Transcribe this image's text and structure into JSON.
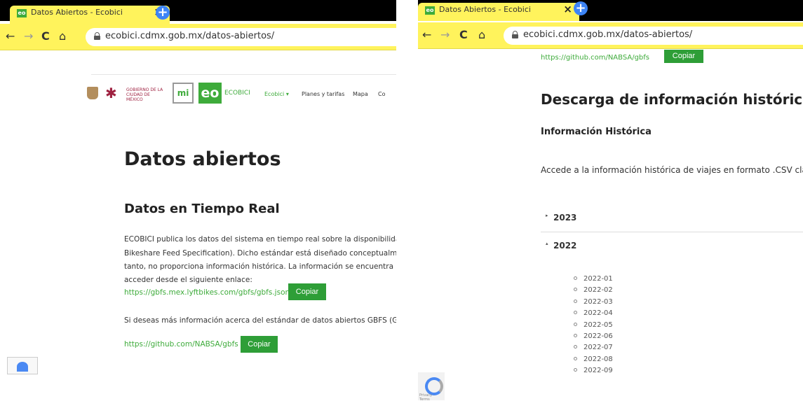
{
  "left": {
    "browser": {
      "tab_title": "Datos Abiertos - Ecobici",
      "url": "ecobici.cdmx.gob.mx/datos-abiertos/"
    },
    "header": {
      "gov_text": "GOBIERNO DE LA CIUDAD DE MÉXICO",
      "mi_logo": "mi",
      "logo_text": "eo",
      "brand": "ECOBICI",
      "nav": [
        "Ecobici ▾",
        "Planes y tarifas",
        "Mapa",
        "Co"
      ]
    },
    "page_title": "Datos abiertos",
    "section_title": "Datos en Tiempo Real",
    "paragraph_lines": [
      "ECOBICI publica los datos del sistema en tiempo real sobre la disponibilidac",
      "Bikeshare Feed Specification). Dicho estándar está diseñado conceptualmer",
      "tanto, no proporciona información histórica. La información se encuentra d",
      "acceder desde el siguiente enlace:"
    ],
    "gbfs_link": "https://gbfs.mex.lyftbikes.com/gbfs/gbfs.json",
    "copy_label": "Copiar",
    "more_info": "Si deseas más información acerca del estándar de datos abiertos GBFS (Gen",
    "github_link": "https://github.com/NABSA/gbfs",
    "copy_label_2": "Copiar"
  },
  "right": {
    "browser": {
      "tab_title": "Datos Abiertos - Ecobici",
      "url": "ecobici.cdmx.gob.mx/datos-abiertos/"
    },
    "github_link": "https://github.com/NABSA/gbfs",
    "copy_label": "Copiar",
    "section_title": "Descarga de información histórica",
    "subtitle": "Información Histórica",
    "paragraph": "Accede a la información histórica de viajes en formato .CSV clasif",
    "years": [
      {
        "label": "2023",
        "caret": "▸"
      },
      {
        "label": "2022",
        "caret": "▴"
      }
    ],
    "months": [
      "2022-01",
      "2022-02",
      "2022-03",
      "2022-04",
      "2022-05",
      "2022-06",
      "2022-07",
      "2022-08",
      "2022-09"
    ],
    "privacy_text": "Privacy - Terms"
  },
  "colors": {
    "browser_theme": "#fff35c",
    "ecobici_green": "#3eab3b",
    "button_green": "#2e9e37"
  },
  "icons": [
    "ecobici-favicon",
    "close-icon",
    "new-tab-icon",
    "back-icon",
    "forward-icon",
    "reload-icon",
    "home-icon",
    "lock-icon",
    "recaptcha-icon"
  ]
}
